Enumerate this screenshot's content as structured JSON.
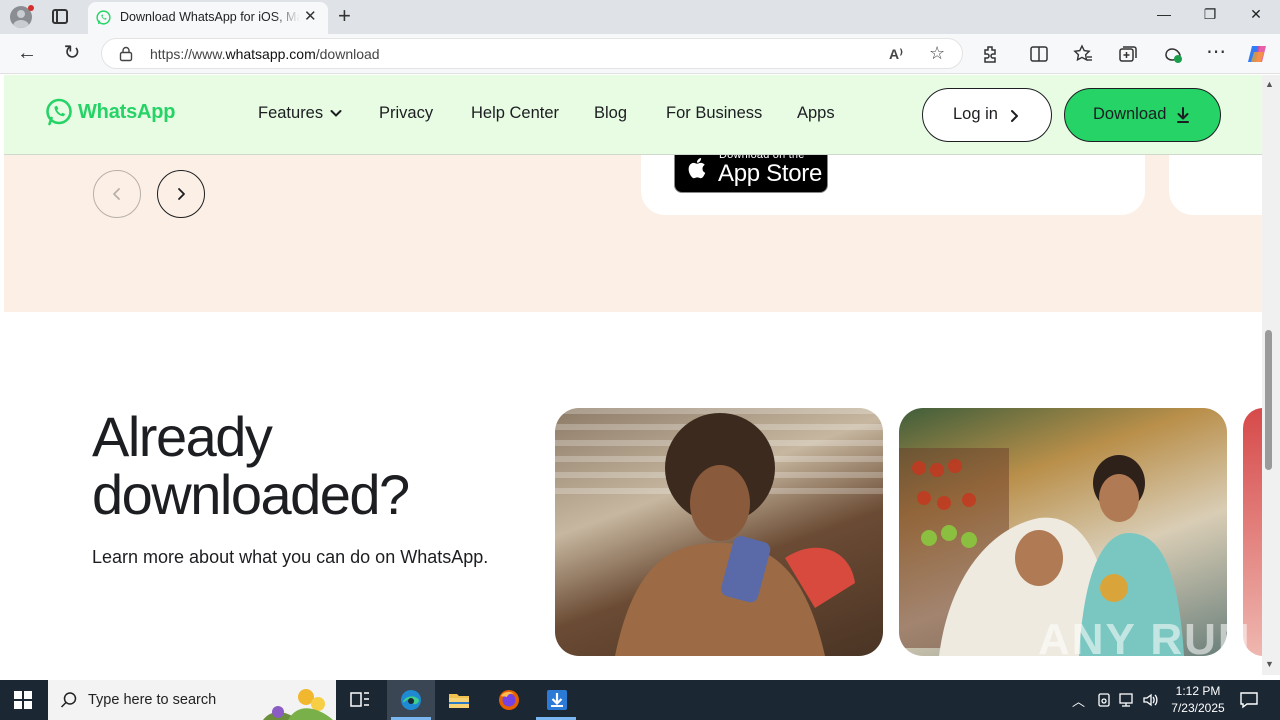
{
  "browser": {
    "tab_title": "Download WhatsApp for iOS, Mac and PC",
    "address_prefix": "https://www.",
    "address_domain": "whatsapp.com",
    "address_path": "/download"
  },
  "page": {
    "header": {
      "logo_text": "WhatsApp",
      "nav": [
        "Features",
        "Privacy",
        "Help Center",
        "Blog",
        "For Business",
        "Apps"
      ],
      "login_label": "Log in",
      "download_label": "Download"
    },
    "app_store": {
      "small": "Download on the",
      "big": "App Store"
    },
    "headline": "Already downloaded?",
    "headline_line1": "Already",
    "headline_line2": "downloaded?",
    "subtext": "Learn more about what you can do on WhatsApp.",
    "watermark": "ANY RUN"
  },
  "taskbar": {
    "search_placeholder": "Type here to search",
    "time": "1:12 PM",
    "date": "7/23/2025"
  },
  "colors": {
    "whatsapp_green": "#25d366",
    "header_bg": "#e7fce3",
    "peach_bg": "#fcefe5"
  }
}
